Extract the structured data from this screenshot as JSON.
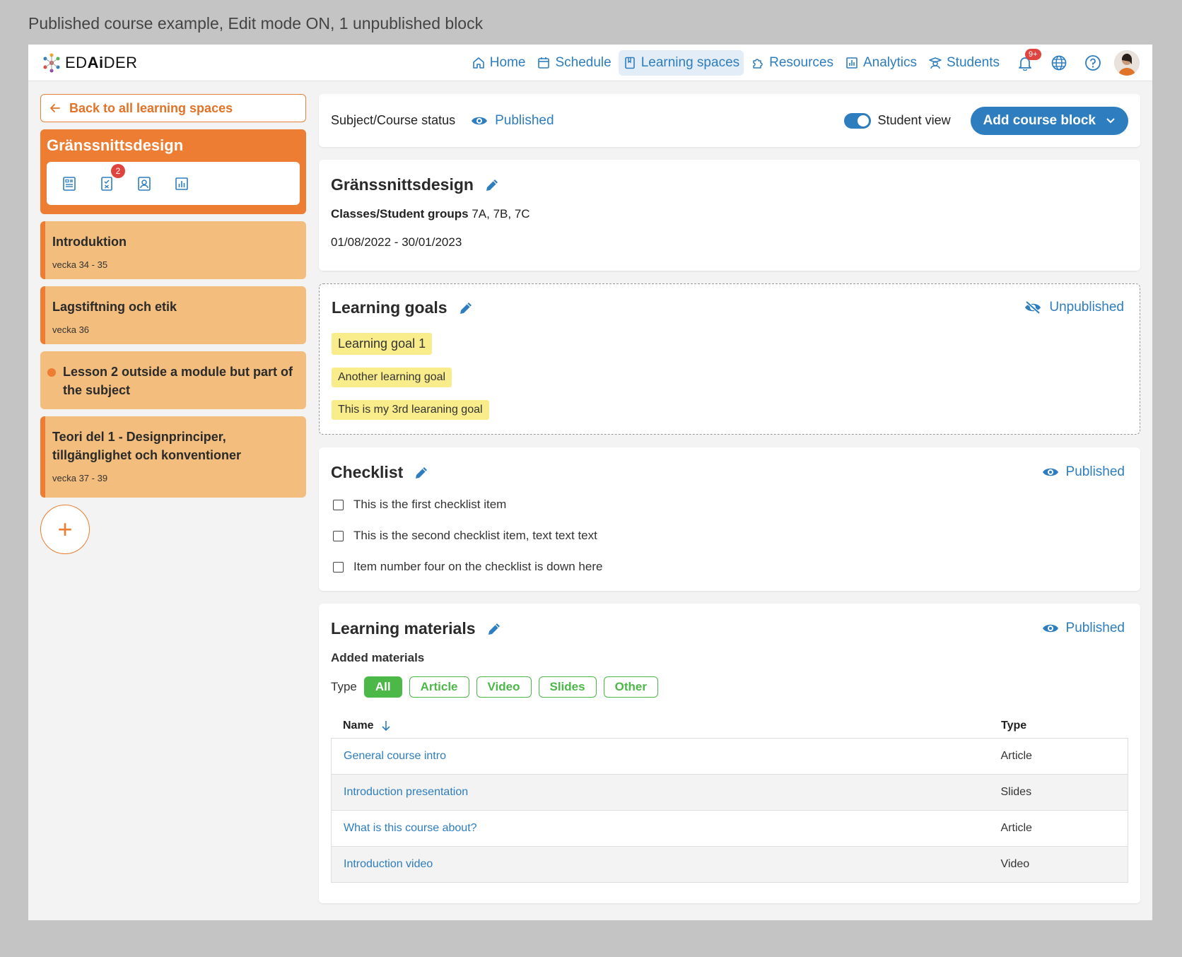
{
  "caption": "Published course example, Edit mode ON, 1 unpublished block",
  "logo": {
    "text_pre": "ED",
    "text_bold": "Ai",
    "text_post": "DER"
  },
  "nav": {
    "home": "Home",
    "schedule": "Schedule",
    "learning_spaces": "Learning spaces",
    "resources": "Resources",
    "analytics": "Analytics",
    "students": "Students",
    "notifications_badge": "9+"
  },
  "sidebar": {
    "back_label": "Back to all learning spaces",
    "course_title": "Gränssnittsdesign",
    "tool_badge": "2",
    "modules": [
      {
        "title": "Introduktion",
        "week": "vecka 34 - 35"
      },
      {
        "title": "Lagstiftning och etik",
        "week": "vecka 36"
      },
      {
        "title": "Lesson 2 outside a module but part of the subject"
      },
      {
        "title": "Teori del 1 - Designprinciper, tillgänglighet och konventioner",
        "week": "vecka 37 - 39"
      }
    ],
    "add_label": "+"
  },
  "status_bar": {
    "label": "Subject/Course status",
    "status": "Published",
    "student_view_label": "Student view",
    "student_view_on": true,
    "add_block_label": "Add course block"
  },
  "course_info": {
    "title": "Gränssnittsdesign",
    "groups_label": "Classes/Student groups",
    "groups_value": "7A, 7B, 7C",
    "dates": "01/08/2022 - 30/01/2023"
  },
  "learning_goals": {
    "title": "Learning goals",
    "status": "Unpublished",
    "goals": [
      "Learning goal 1",
      "Another learning goal",
      "This is my 3rd learaning goal"
    ]
  },
  "checklist": {
    "title": "Checklist",
    "status": "Published",
    "items": [
      "This is the first checklist item",
      "This is the second checklist item, text text text",
      "Item number four on the checklist is down here"
    ]
  },
  "materials": {
    "title": "Learning materials",
    "status": "Published",
    "subtitle": "Added materials",
    "type_label": "Type",
    "filters": [
      "All",
      "Article",
      "Video",
      "Slides",
      "Other"
    ],
    "active_filter": "All",
    "col_name": "Name",
    "col_type": "Type",
    "rows": [
      {
        "name": "General course intro",
        "type": "Article"
      },
      {
        "name": "Introduction presentation",
        "type": "Slides"
      },
      {
        "name": "What is this course about?",
        "type": "Article"
      },
      {
        "name": "Introduction video",
        "type": "Video"
      }
    ]
  },
  "colors": {
    "accent_blue": "#2d7dbf",
    "orange": "#ec7d32",
    "module_bg": "#f3bd7d",
    "goal_highlight": "#f9ec8a",
    "filter_green": "#4cb848",
    "badge_red": "#e0443e"
  }
}
